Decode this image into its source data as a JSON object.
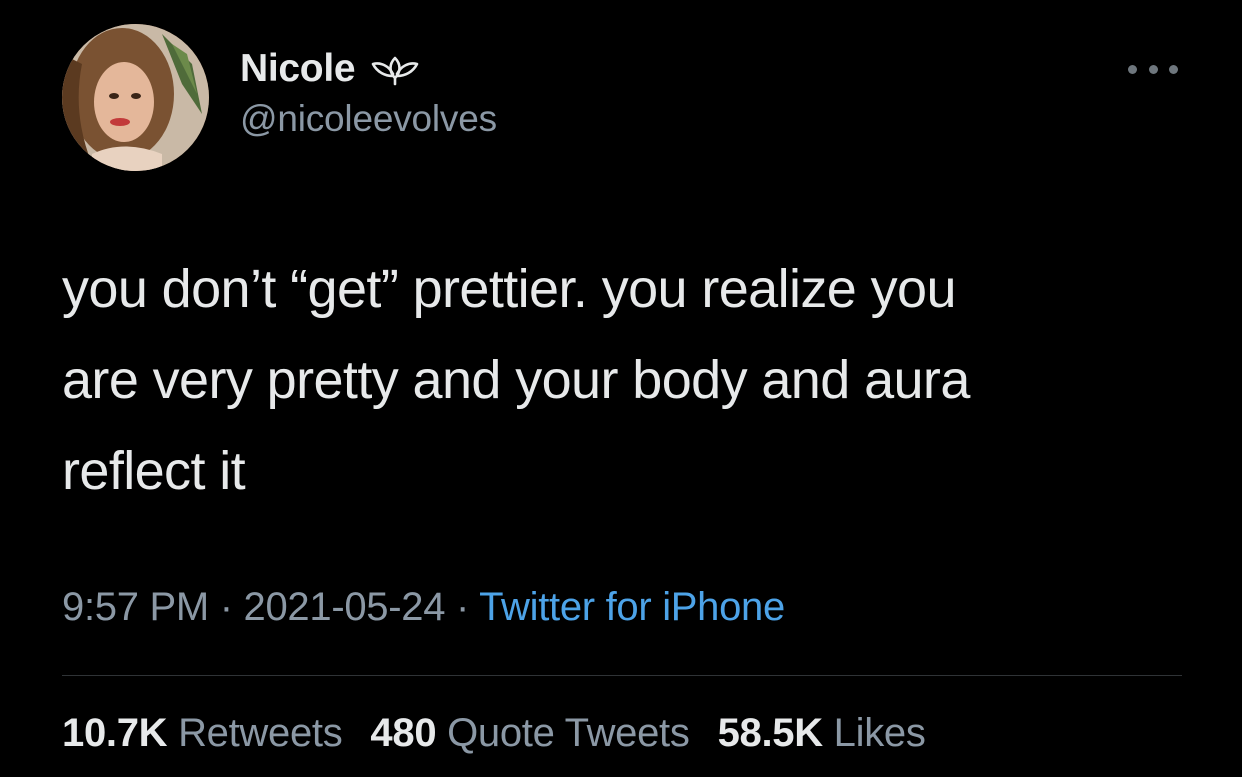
{
  "author": {
    "display_name": "Nicole",
    "handle": "@nicoleevolves",
    "badge_icon": "flower-icon",
    "avatar_icon": "profile-photo"
  },
  "tweet": {
    "text": "you don’t “get” prettier. you realize you\nare very pretty and your body and aura\nreflect it"
  },
  "meta": {
    "time": "9:57 PM",
    "separator": " · ",
    "date": "2021-05-24",
    "source": "Twitter for iPhone"
  },
  "stats": {
    "retweets_count": "10.7K",
    "retweets_label": "Retweets",
    "quotes_count": "480",
    "quotes_label": "Quote Tweets",
    "likes_count": "58.5K",
    "likes_label": "Likes"
  },
  "colors": {
    "background": "#000000",
    "text_primary": "#e7e9ea",
    "text_secondary": "#8b98a5",
    "link": "#4da3e8",
    "divider": "#2f3336"
  }
}
